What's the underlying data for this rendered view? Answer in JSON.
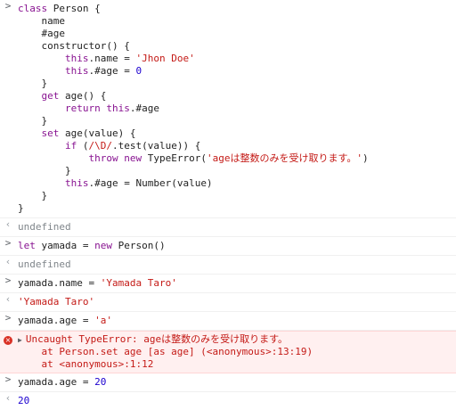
{
  "entries": {
    "class_def": {
      "lines": {
        "l1": {
          "kw": "class",
          "rest": " Person {"
        },
        "l2": {
          "text": "    name"
        },
        "l3": {
          "text": "    #age"
        },
        "l4": {
          "text": "    constructor() {"
        },
        "l5": {
          "a": "        this",
          "b": ".name = ",
          "c": "'Jhon Doe'"
        },
        "l6": {
          "a": "        this",
          "b": ".#age = ",
          "c": "0"
        },
        "l7": {
          "text": "    }"
        },
        "l8": {
          "a": "    get",
          "b": " age() {"
        },
        "l9": {
          "a": "        return",
          "b": " ",
          "c": "this",
          "d": ".#age"
        },
        "l10": {
          "text": "    }"
        },
        "l11": {
          "a": "    set",
          "b": " age(value) {"
        },
        "l12": {
          "a": "        if",
          "b": " (",
          "c": "/\\D/",
          "d": ".test(value)) {"
        },
        "l13": {
          "a": "            throw",
          "b": " ",
          "c": "new",
          "d": " TypeError(",
          "e": "'ageは整数のみを受け取ります。'",
          "f": ")"
        },
        "l14": {
          "text": "        }"
        },
        "l15": {
          "a": "        this",
          "b": ".#age = Number(value)"
        },
        "l16": {
          "text": "    }"
        },
        "l17": {
          "text": "}"
        }
      }
    },
    "result1": "undefined",
    "cmd2": {
      "a": "let",
      "b": " yamada = ",
      "c": "new",
      "d": " Person()"
    },
    "result2": "undefined",
    "cmd3": {
      "a": "yamada.name = ",
      "b": "'Yamada Taro'"
    },
    "result3": "'Yamada Taro'",
    "cmd4": {
      "a": "yamada.age = ",
      "b": "'a'"
    },
    "error": {
      "title": "Uncaught TypeError: ageは整数のみを受け取ります。",
      "trace1": "    at Person.set age [as age] (<anonymous>:13:19)",
      "trace2": "    at <anonymous>:1:12"
    },
    "cmd5": {
      "a": "yamada.age = ",
      "b": "20"
    },
    "result5": "20"
  },
  "icons": {
    "input_prompt": ">",
    "result_arrow": "‹",
    "error_icon": "×",
    "expand": "▶"
  },
  "colors": {
    "keyword": "#881391",
    "string": "#c41a16",
    "number": "#1c00cf",
    "error_bg": "#fff0f0"
  }
}
